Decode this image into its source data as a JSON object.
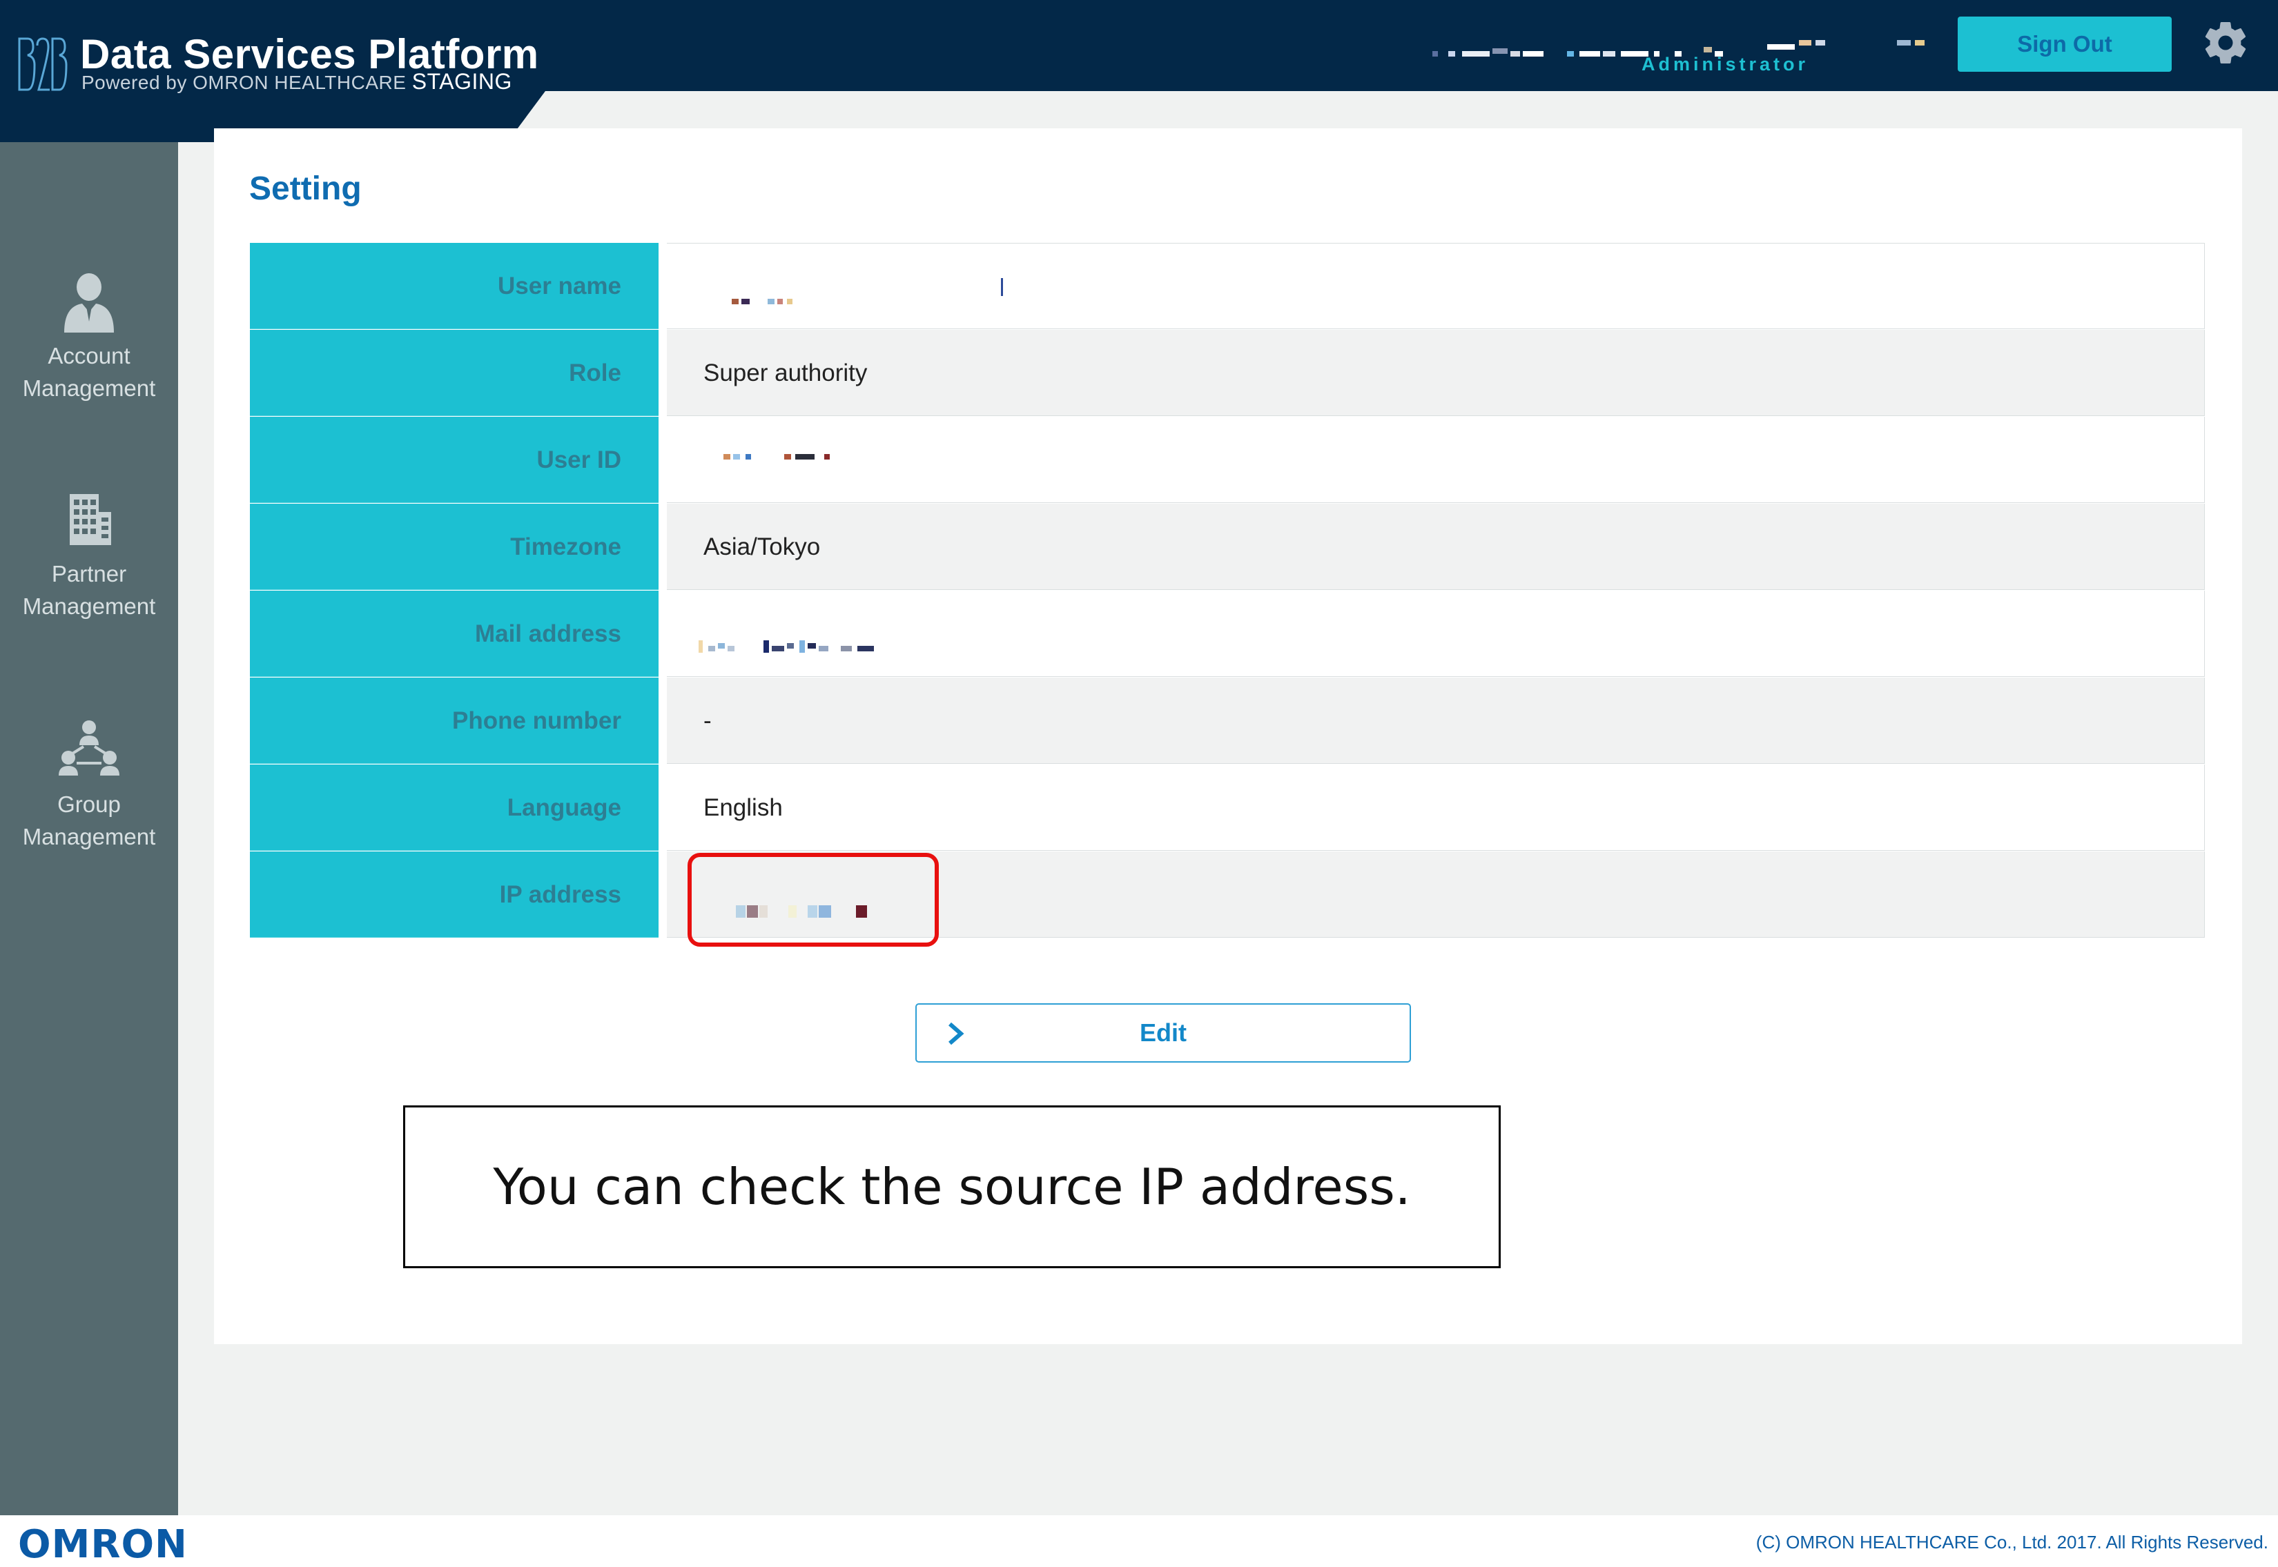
{
  "header": {
    "logo_text": "B2B",
    "title": "Data Services Platform",
    "subtitle": "Powered by OMRON HEALTHCARE",
    "environment": "STAGING",
    "user_role": "Administrator",
    "signout_label": "Sign Out",
    "settings_icon": "gear-icon"
  },
  "sidebar": {
    "items": [
      {
        "line1": "Account",
        "line2": "Management",
        "icon": "person-icon"
      },
      {
        "line1": "Partner",
        "line2": "Management",
        "icon": "building-icon"
      },
      {
        "line1": "Group",
        "line2": "Management",
        "icon": "group-icon"
      }
    ]
  },
  "main": {
    "title": "Setting",
    "rows": [
      {
        "label": "User name",
        "value": ""
      },
      {
        "label": "Role",
        "value": "Super authority"
      },
      {
        "label": "User ID",
        "value": ""
      },
      {
        "label": "Timezone",
        "value": "Asia/Tokyo"
      },
      {
        "label": "Mail address",
        "value": ""
      },
      {
        "label": "Phone number",
        "value": "-"
      },
      {
        "label": "Language",
        "value": "English"
      },
      {
        "label": "IP address",
        "value": ""
      }
    ],
    "edit_label": "Edit",
    "callout": "You can check the source IP address."
  },
  "footer": {
    "logo": "OMRON",
    "copyright": "(C) OMRON HEALTHCARE Co., Ltd. 2017. All Rights Reserved."
  },
  "colors": {
    "header_bg": "#032848",
    "accent_cyan": "#1cc0d2",
    "sidebar_bg": "#556a6f",
    "title_blue": "#0f6cb1",
    "highlight_red": "#e8100f"
  }
}
